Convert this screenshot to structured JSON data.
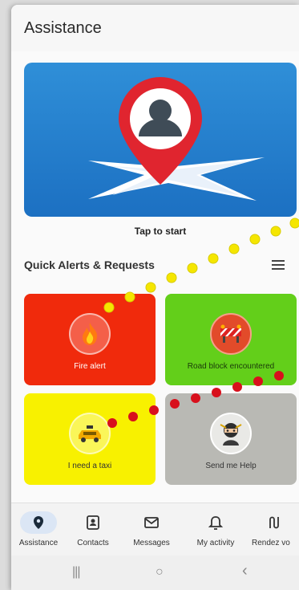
{
  "app": {
    "title": "Assistance"
  },
  "hero": {
    "tap_label": "Tap to start"
  },
  "section": {
    "title": "Quick Alerts & Requests"
  },
  "tiles": [
    {
      "label": "Fire alert",
      "icon": "flame-icon",
      "color": "#f02a0c"
    },
    {
      "label": "Road block encountered",
      "icon": "roadblock-icon",
      "color": "#63cf1a"
    },
    {
      "label": "I need a taxi",
      "icon": "taxi-icon",
      "color": "#f8f100"
    },
    {
      "label": "Send me Help",
      "icon": "ninja-icon",
      "color": "#b9b9b4"
    }
  ],
  "nav": [
    {
      "label": "Assistance",
      "icon": "location-pin-icon",
      "active": true
    },
    {
      "label": "Contacts",
      "icon": "contact-card-icon"
    },
    {
      "label": "Messages",
      "icon": "mail-icon"
    },
    {
      "label": "My activity",
      "icon": "bell-icon"
    },
    {
      "label": "Rendez vo",
      "icon": "route-icon"
    }
  ],
  "system_nav": {
    "recents": "|||",
    "home": "○",
    "back": "‹"
  },
  "colors": {
    "accent": "#1c70c2",
    "pin": "#e0252f",
    "dot_yellow": "#f5e600",
    "dot_red": "#d8101c"
  }
}
